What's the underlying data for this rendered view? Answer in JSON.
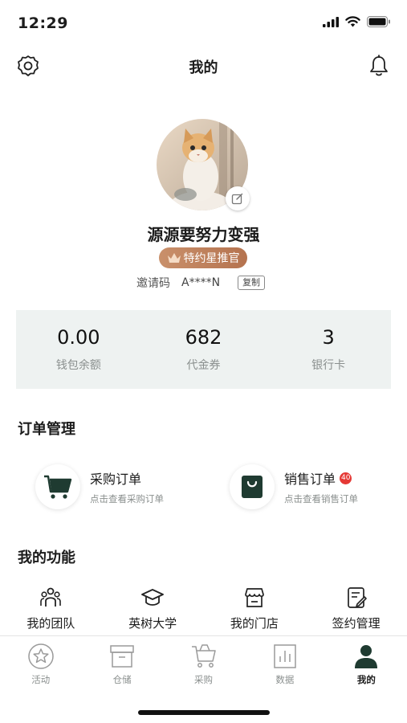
{
  "status_bar": {
    "time": "12:29"
  },
  "nav": {
    "title": "我的",
    "settings_icon": "gear-icon",
    "notification_icon": "bell-icon"
  },
  "profile": {
    "username": "源源要努力变强",
    "badge": "特约星推官",
    "invite_label": "邀请码",
    "invite_code": "A****N",
    "copy_label": "复制"
  },
  "stats": [
    {
      "value": "0.00",
      "label": "钱包余额"
    },
    {
      "value": "682",
      "label": "代金券"
    },
    {
      "value": "3",
      "label": "银行卡"
    }
  ],
  "orders": {
    "title": "订单管理",
    "items": [
      {
        "title": "采购订单",
        "subtitle": "点击查看采购订单",
        "icon": "cart-icon"
      },
      {
        "title": "销售订单",
        "subtitle": "点击查看销售订单",
        "icon": "shopping-bag-icon",
        "badge": "40"
      }
    ]
  },
  "functions": {
    "title": "我的功能",
    "items": [
      {
        "label": "我的团队",
        "icon": "team-icon"
      },
      {
        "label": "英树大学",
        "icon": "graduation-cap-icon"
      },
      {
        "label": "我的门店",
        "icon": "store-icon"
      },
      {
        "label": "签约管理",
        "icon": "contract-icon"
      }
    ]
  },
  "tabs": [
    {
      "label": "活动",
      "icon": "star-icon",
      "active": false
    },
    {
      "label": "仓储",
      "icon": "warehouse-icon",
      "active": false
    },
    {
      "label": "采购",
      "icon": "cart-icon",
      "active": false
    },
    {
      "label": "数据",
      "icon": "chart-icon",
      "active": false
    },
    {
      "label": "我的",
      "icon": "person-icon",
      "active": true
    }
  ],
  "colors": {
    "accent": "#1f3b31",
    "badge_gradient_start": "#c9906b",
    "badge_gradient_end": "#b5734f",
    "stats_bg": "#eef2f1",
    "notification_badge": "#e53935"
  }
}
